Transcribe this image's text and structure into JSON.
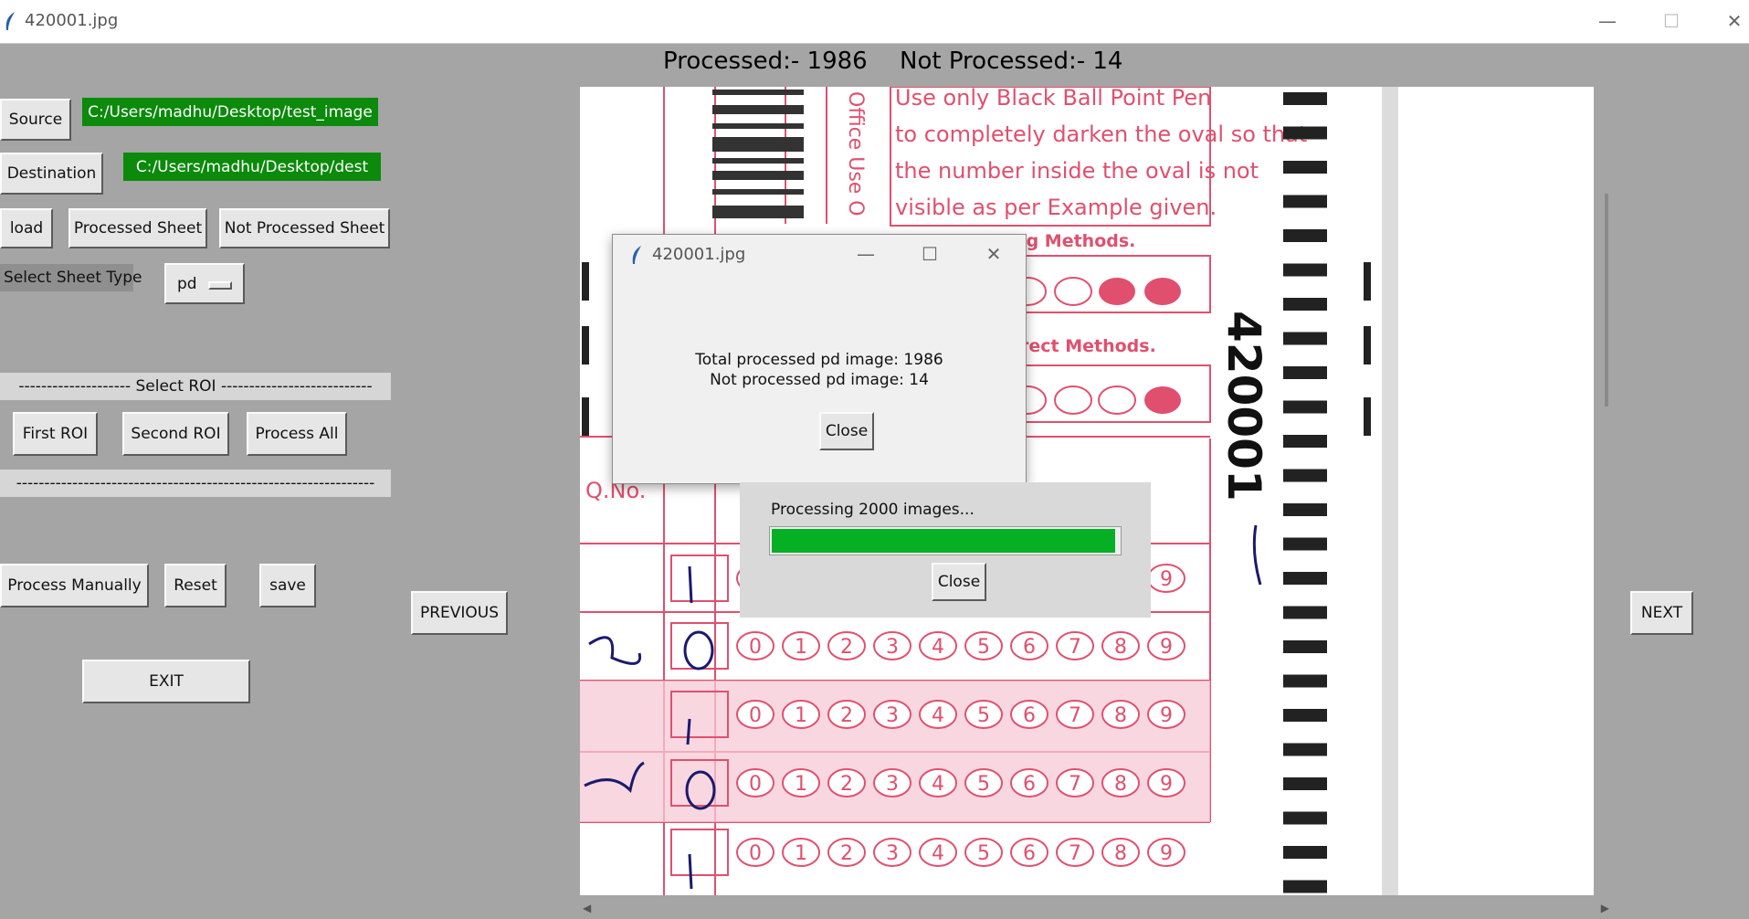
{
  "window": {
    "title": "420001.jpg",
    "minimize": "—",
    "maximize": "☐",
    "close": "✕"
  },
  "status": {
    "processed": "Processed:- 1986",
    "not_processed": "Not Processed:- 14"
  },
  "left_panel": {
    "source_button": "Source",
    "source_path": "C:/Users/madhu/Desktop/test_image",
    "destination_button": "Destination",
    "destination_path": "C:/Users/madhu/Desktop/dest",
    "load_button": "load",
    "processed_sheet_button": "Processed Sheet",
    "not_processed_sheet_button": "Not Processed Sheet",
    "sheet_type_label": "Select Sheet Type",
    "sheet_type_value": "pd",
    "roi_separator": "-------------------- Select ROI ---------------------------",
    "first_roi_button": "First ROI",
    "second_roi_button": "Second ROI",
    "process_all_button": "Process All",
    "bottom_separator": "----------------------------------------------------------------",
    "process_manually_button": "Process Manually",
    "reset_button": "Reset",
    "save_button": "save",
    "exit_button": "EXIT"
  },
  "viewer": {
    "previous_button": "PREVIOUS",
    "next_button": "NEXT"
  },
  "sheet": {
    "instructions": [
      "Use only Black Ball Point Pen",
      "to completely darken the oval so that",
      "the number inside the oval is not",
      "visible as per Example given."
    ],
    "office_use": "Office Use O",
    "wrong_methods": "ong Methods.",
    "correct_methods": "rect Methods.",
    "qno_label": "Q.No.",
    "sheet_number": "420001",
    "digits": [
      "0",
      "1",
      "2",
      "3",
      "4",
      "5",
      "6",
      "7",
      "8",
      "9"
    ]
  },
  "dialog": {
    "title": "420001.jpg",
    "line1": "Total processed pd image: 1986",
    "line2": "Not processed pd image: 14",
    "close": "Close"
  },
  "progress": {
    "text": "Processing 2000 images...",
    "close": "Close",
    "fraction": 0.99,
    "color": "#06b025"
  }
}
